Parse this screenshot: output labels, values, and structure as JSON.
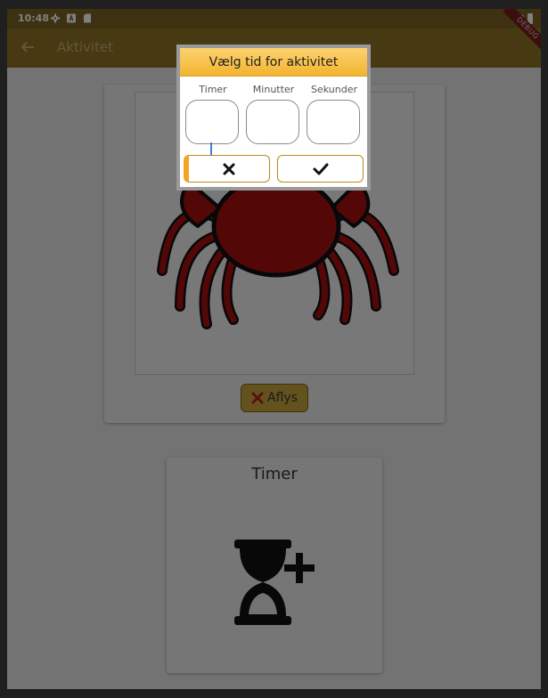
{
  "status_bar": {
    "time": "10:48"
  },
  "app_bar": {
    "title": "Aktivitet",
    "debug_banner": "DEBUG"
  },
  "activity": {
    "cancel_label": "Aflys"
  },
  "timer_card": {
    "title": "Timer"
  },
  "dialog": {
    "title": "Vælg tid for aktivitet",
    "fields": [
      {
        "label": "Timer",
        "value": ""
      },
      {
        "label": "Minutter",
        "value": ""
      },
      {
        "label": "Sekunder",
        "value": ""
      }
    ]
  },
  "colors": {
    "accent": "#f3b32f",
    "app_bar": "#8e7526",
    "cancel_red": "#b71c1c"
  },
  "icons": [
    "back-arrow-icon",
    "gear-icon",
    "a-icon",
    "sd-card-icon",
    "wifi-icon",
    "battery-icon",
    "close-icon",
    "check-icon",
    "hourglass-add-icon"
  ]
}
